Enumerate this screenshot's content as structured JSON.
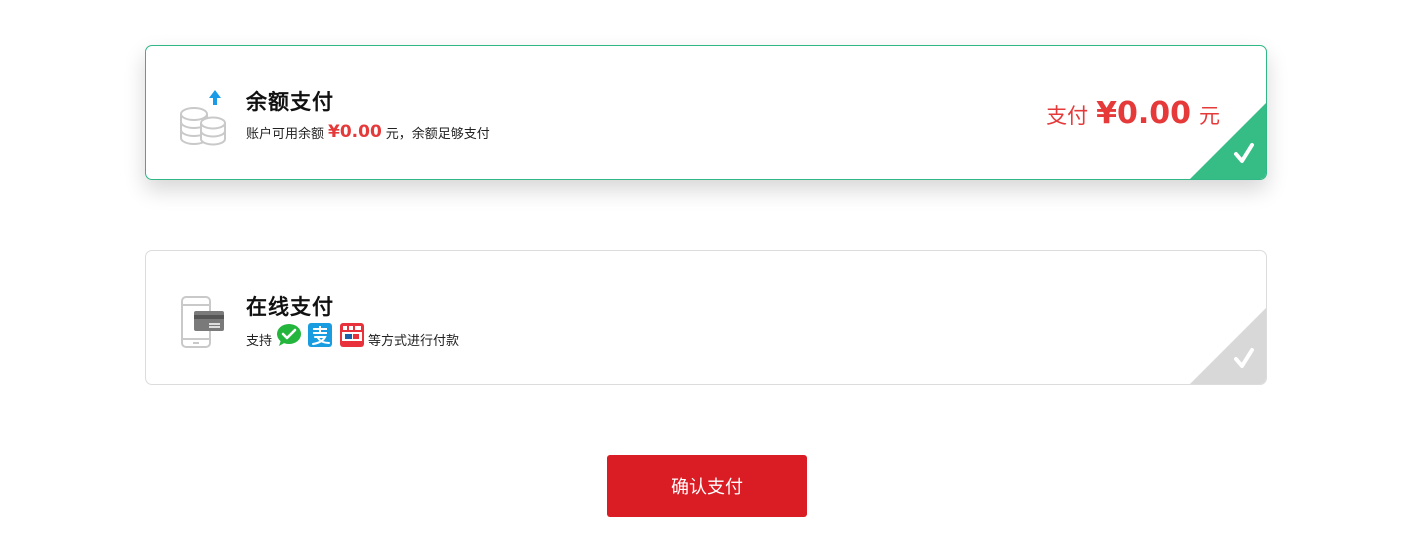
{
  "colors": {
    "accent_red": "#e5393a",
    "selected_border": "#2fb786",
    "selected_corner": "#35bd85",
    "unselected_corner": "#d8d8d8",
    "button_bg": "#da1c24"
  },
  "balance_payment": {
    "icon": "coins-upload-icon",
    "title": "余额支付",
    "desc_prefix": "账户可用余额",
    "desc_amount": "¥0.00",
    "desc_suffix": "元，余额足够支付",
    "pay_label": "支付",
    "pay_amount": "¥0.00",
    "pay_unit": "元",
    "selected": true,
    "check_icon": "checkmark-icon"
  },
  "online_payment": {
    "icon": "phone-card-icon",
    "title": "在线支付",
    "desc_prefix": "支持",
    "logos": [
      "wechat-pay-icon",
      "alipay-icon",
      "unionpay-icon"
    ],
    "desc_suffix": "等方式进行付款",
    "selected": false,
    "check_icon": "checkmark-icon"
  },
  "confirm_button": {
    "label": "确认支付"
  }
}
